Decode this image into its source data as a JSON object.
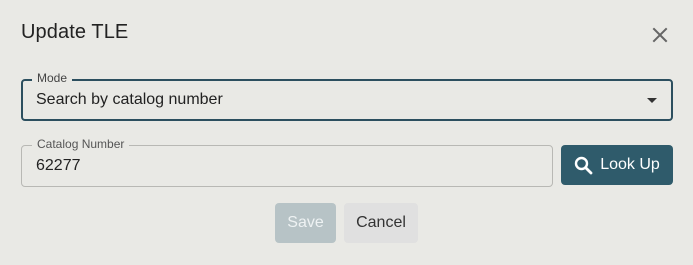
{
  "dialog": {
    "title": "Update TLE",
    "close_icon": "close-icon"
  },
  "mode_field": {
    "label": "Mode",
    "value": "Search by catalog number",
    "icon": "chevron-down-icon"
  },
  "catalog_field": {
    "label": "Catalog Number",
    "value": "62277"
  },
  "lookup_button": {
    "label": "Look Up",
    "icon": "search-icon"
  },
  "actions": {
    "save_label": "Save",
    "save_enabled": false,
    "cancel_label": "Cancel"
  },
  "colors": {
    "background": "#e9e9e5",
    "primary": "#2f5b6b",
    "focused_border": "#2c4f5f",
    "disabled_button": "#b7c3c6"
  }
}
